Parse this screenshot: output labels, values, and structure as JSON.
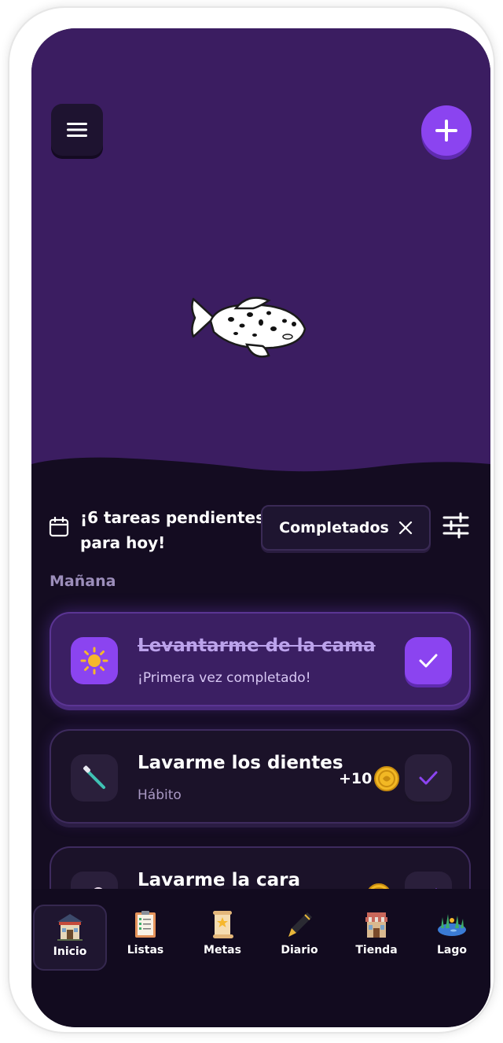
{
  "header": {
    "menu_icon": "hamburger-menu-icon",
    "add_icon": "plus-icon",
    "pet": "koi-fish"
  },
  "summary": {
    "text": "¡6 tareas pendientes para hoy!",
    "calendar_icon": "calendar-icon"
  },
  "filter": {
    "chip_label": "Completados",
    "clear_icon": "close-icon",
    "settings_icon": "sliders-icon"
  },
  "section": {
    "title": "Mañana"
  },
  "tasks": [
    {
      "title": "Levantarme de la cama",
      "subtitle": "¡Primera vez completado!",
      "icon": "sun-icon",
      "completed": true
    },
    {
      "title": "Lavarme los dientes",
      "subtitle": "Hábito",
      "icon": "toothbrush-icon",
      "reward": "+10",
      "reward_icon": "coin-icon",
      "completed": false
    },
    {
      "title": "Lavarme la cara",
      "icon": "soap-icon",
      "reward_icon": "coin-icon",
      "completed": false
    }
  ],
  "nav": {
    "items": [
      {
        "label": "Inicio",
        "icon": "home-icon",
        "active": true
      },
      {
        "label": "Listas",
        "icon": "list-icon",
        "active": false
      },
      {
        "label": "Metas",
        "icon": "scroll-icon",
        "active": false
      },
      {
        "label": "Diario",
        "icon": "pen-icon",
        "active": false
      },
      {
        "label": "Tienda",
        "icon": "shop-icon",
        "active": false
      },
      {
        "label": "Lago",
        "icon": "lake-icon",
        "active": false
      }
    ]
  },
  "colors": {
    "hero_bg": "#3b1d61",
    "app_bg": "#140c21",
    "accent": "#8b44f0"
  }
}
